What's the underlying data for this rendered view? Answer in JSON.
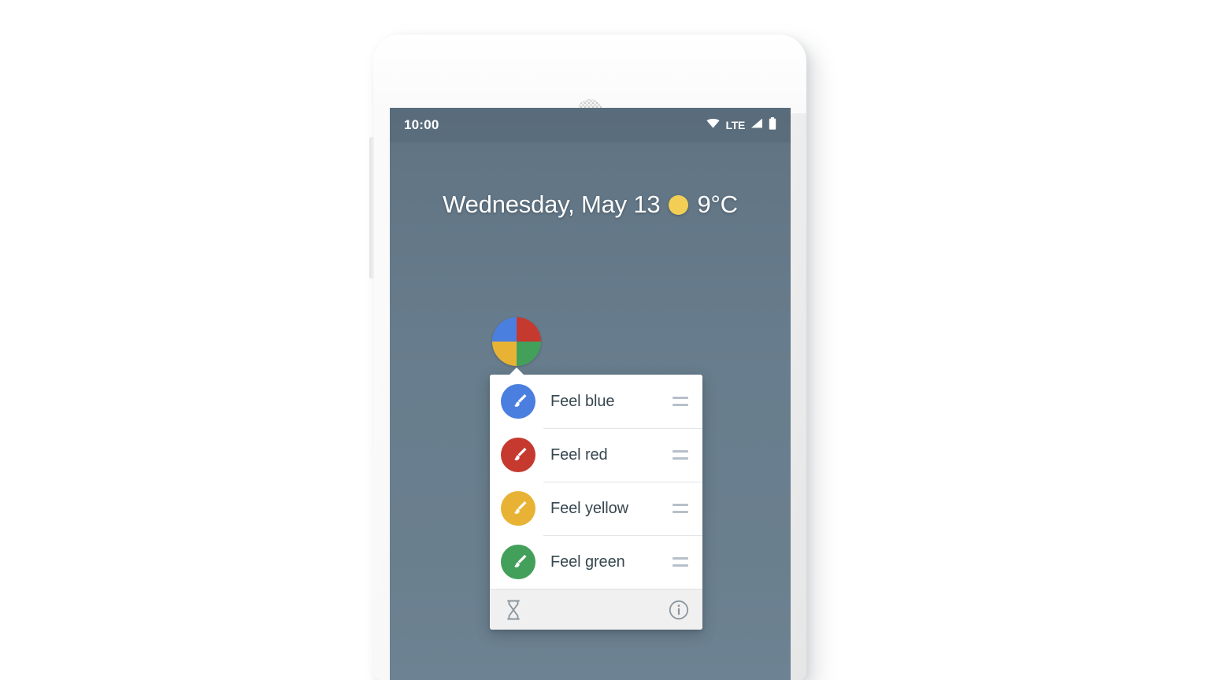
{
  "device": {
    "speaker_icon": "speaker-grille-icon",
    "volume_button": "volume-button"
  },
  "status_bar": {
    "time": "10:00",
    "wifi_icon": "wifi-icon",
    "network_label": "LTE",
    "signal_icon": "signal-bars-icon",
    "battery_icon": "battery-icon"
  },
  "home_screen": {
    "widget": {
      "date": "Wednesday, May 13",
      "weather_icon": "sun-icon",
      "temperature": "9°C"
    },
    "app_icon": {
      "name": "four-color-app-icon",
      "quadrants": [
        {
          "position": "top-left",
          "color": "#4a7fe0"
        },
        {
          "position": "top-right",
          "color": "#c5392f"
        },
        {
          "position": "bottom-left",
          "color": "#e8b335"
        },
        {
          "position": "bottom-right",
          "color": "#43a05b"
        }
      ]
    },
    "wallpaper_color": "#667b8c"
  },
  "popup": {
    "items": [
      {
        "label": "Feel blue",
        "color": "#4a7fe0",
        "icon": "paintbrush-icon",
        "handle_icon": "drag-handle-icon"
      },
      {
        "label": "Feel red",
        "color": "#c5392f",
        "icon": "paintbrush-icon",
        "handle_icon": "drag-handle-icon"
      },
      {
        "label": "Feel yellow",
        "color": "#e8b335",
        "icon": "paintbrush-icon",
        "handle_icon": "drag-handle-icon"
      },
      {
        "label": "Feel green",
        "color": "#43a05b",
        "icon": "paintbrush-icon",
        "handle_icon": "drag-handle-icon"
      }
    ],
    "footer": {
      "left_icon": "hourglass-icon",
      "right_icon": "info-icon"
    }
  }
}
